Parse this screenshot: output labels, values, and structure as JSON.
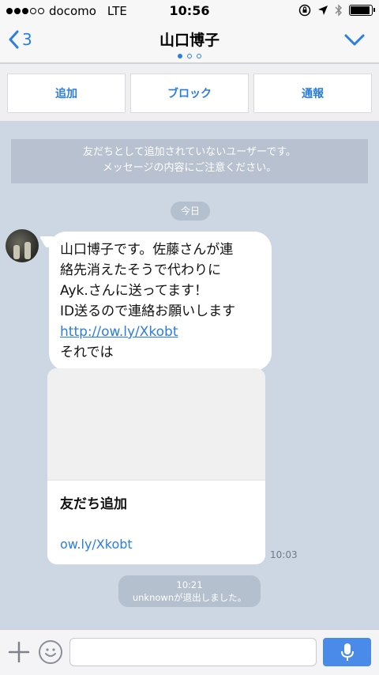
{
  "status_bar": {
    "carrier": "docomo",
    "network": "LTE",
    "time": "10:56",
    "signal_bars": 3,
    "signal_total": 5,
    "battery_level": 0.92
  },
  "header": {
    "back_count": "3",
    "title": "山口博子",
    "page_count": 3,
    "active_page": 1,
    "accent": "#2a7de1"
  },
  "actions": {
    "add": "追加",
    "block": "ブロック",
    "report": "通報"
  },
  "notice": {
    "line1": "友だちとして追加されていないユーザーです。",
    "line2": "メッセージの内容にご注意ください。"
  },
  "date_separator": "今日",
  "message": {
    "lines": [
      "山口博子です。佐藤さんが連",
      "絡先消えたそうで代わりに",
      "Ayk.さんに送ってます！",
      "ID送るので連絡お願いします"
    ],
    "link": "http://ow.ly/Xkobt",
    "last_line": "それでは"
  },
  "card": {
    "title": "友だち追加",
    "link": "ow.ly/Xkobt"
  },
  "message_time": "10:03",
  "system": {
    "time": "10:21",
    "text": "unknownが退出しました。"
  },
  "input": {
    "placeholder": "",
    "icons": [
      "plus-icon",
      "emoji-icon",
      "microphone-icon"
    ]
  }
}
